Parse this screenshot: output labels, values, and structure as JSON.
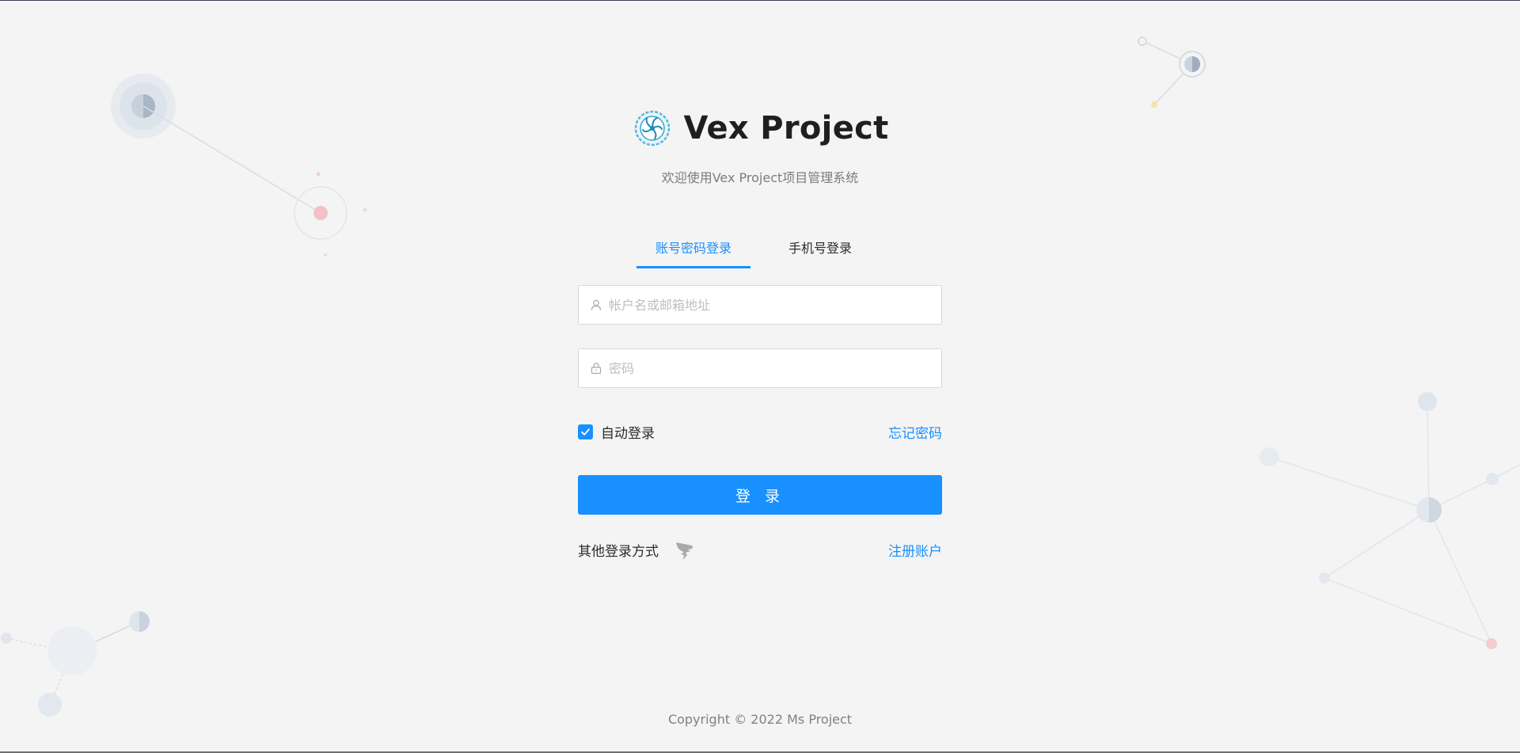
{
  "brand": {
    "name": "Vex Project",
    "subtitle": "欢迎使用Vex Project项目管理系统"
  },
  "tabs": [
    {
      "label": "账号密码登录",
      "active": true
    },
    {
      "label": "手机号登录",
      "active": false
    }
  ],
  "form": {
    "username_placeholder": "帐户名或邮箱地址",
    "username_value": "",
    "password_placeholder": "密码",
    "password_value": "",
    "remember_label": "自动登录",
    "remember_checked": true,
    "forgot_password": "忘记密码",
    "login_button": "登 录",
    "other_login_label": "其他登录方式",
    "other_login_icon": "dingtalk-icon",
    "register_link": "注册账户"
  },
  "footer": {
    "copyright": "Copyright © 2022 Ms Project"
  },
  "colors": {
    "accent": "#1890ff",
    "background": "#f4f4f4"
  }
}
